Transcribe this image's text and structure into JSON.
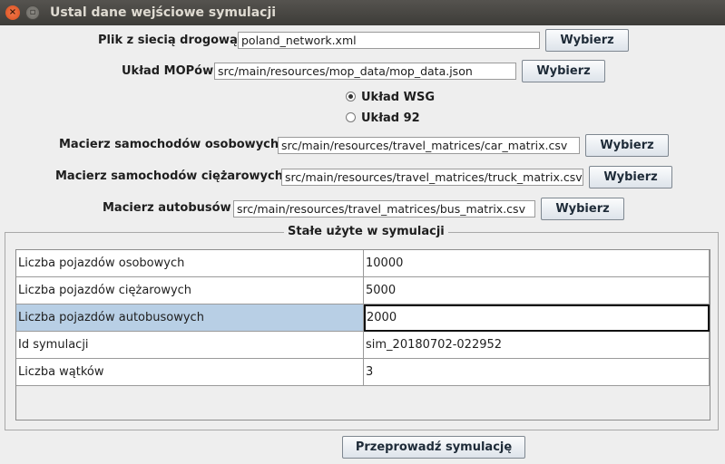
{
  "window": {
    "title": "Ustal dane wejściowe symulacji"
  },
  "inputs": {
    "network": {
      "label": "Plik z siecią drogową",
      "value": "poland_network.xml",
      "button": "Wybierz"
    },
    "mop": {
      "label": "Układ MOPów",
      "value": "src/main/resources/mop_data/mop_data.json",
      "button": "Wybierz"
    },
    "car": {
      "label": "Macierz samochodów osobowych",
      "value": "src/main/resources/travel_matrices/car_matrix.csv",
      "button": "Wybierz"
    },
    "truck": {
      "label": "Macierz samochodów ciężarowych",
      "value": "src/main/resources/travel_matrices/truck_matrix.csv",
      "button": "Wybierz"
    },
    "bus": {
      "label": "Macierz autobusów",
      "value": "src/main/resources/travel_matrices/bus_matrix.csv",
      "button": "Wybierz"
    }
  },
  "coordinate_system": {
    "options": [
      "Układ WSG",
      "Układ 92"
    ],
    "selected": "Układ WSG"
  },
  "constants": {
    "title": "Stałe użyte w symulacji",
    "rows": [
      {
        "name": "Liczba pojazdów osobowych",
        "value": "10000"
      },
      {
        "name": "Liczba pojazdów ciężarowych",
        "value": "5000"
      },
      {
        "name": "Liczba pojazdów autobusowych",
        "value": "2000"
      },
      {
        "name": "Id symulacji",
        "value": "sim_20180702-022952"
      },
      {
        "name": "Liczba wątków",
        "value": "3"
      }
    ],
    "selected_row": "Liczba pojazdów autobusowych"
  },
  "run_button": "Przeprowadź symulację"
}
